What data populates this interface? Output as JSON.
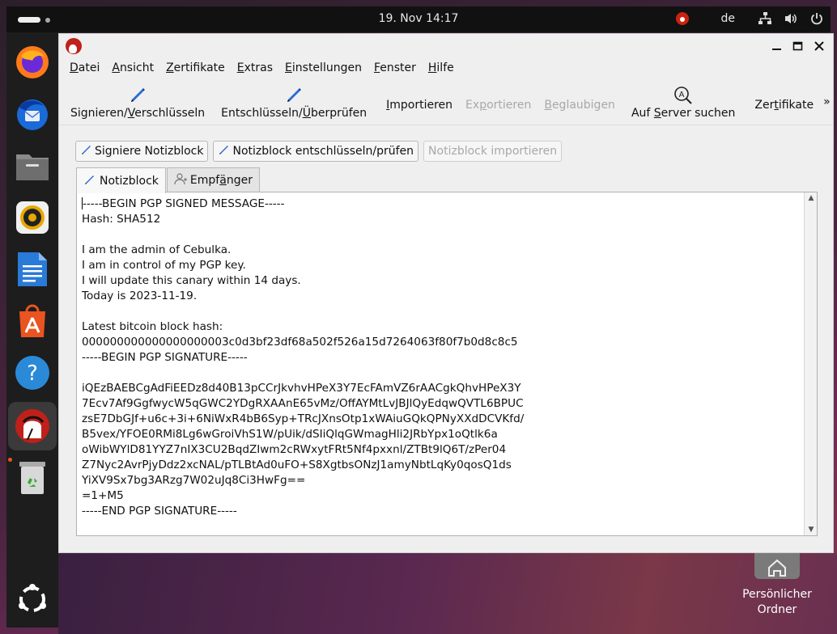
{
  "topbar": {
    "datetime": "19. Nov  14:17",
    "language": "de"
  },
  "dock": {
    "items": [
      "firefox",
      "thunderbird",
      "files",
      "rhythmbox",
      "libreoffice-writer",
      "app-center",
      "help",
      "kleopatra",
      "trash",
      "show-apps"
    ]
  },
  "desktop": {
    "home_folder_line1": "Persönlicher",
    "home_folder_line2": "Ordner"
  },
  "window": {
    "minimize": "—",
    "maximize": "☐",
    "close": "✕"
  },
  "menubar": {
    "datei_u": "D",
    "datei_rest": "atei",
    "ansicht_u": "A",
    "ansicht_rest": "nsicht",
    "zertifikate_u": "Z",
    "zertifikate_rest": "ertifikate",
    "extras_u": "E",
    "extras_rest": "xtras",
    "einstellungen_u": "E",
    "einstellungen_rest": "instellungen",
    "fenster_u": "F",
    "fenster_rest": "enster",
    "hilfe_u": "H",
    "hilfe_rest": "ilfe"
  },
  "toolbar": {
    "sign_a": "Signieren/",
    "sign_u": "V",
    "sign_b": "erschlüsseln",
    "decrypt_a": "Entschlüsseln/",
    "decrypt_u": "Ü",
    "decrypt_b": "berprüfen",
    "import_u": "I",
    "import_b": "mportieren",
    "export_a": "Ex",
    "export_u": "p",
    "export_b": "ortieren",
    "certify_u": "B",
    "certify_b": "eglaubigen",
    "lookup_a": "Auf ",
    "lookup_u": "S",
    "lookup_b": "erver suchen",
    "certificates_a": "Zer",
    "certificates_u": "t",
    "certificates_b": "ifikate",
    "more": "»"
  },
  "actions": {
    "sign_notepad": "Signiere Notizblock",
    "decrypt_notepad": "Notizblock entschlüsseln/prüfen",
    "import_notepad": "Notizblock importieren"
  },
  "tabs": {
    "notepad": "Notizblock",
    "recipients_a": "Empf",
    "recipients_u": "ä",
    "recipients_b": "nger"
  },
  "editor": {
    "content": "-----BEGIN PGP SIGNED MESSAGE-----\nHash: SHA512\n\nI am the admin of Cebulka.\nI am in control of my PGP key.\nI will update this canary within 14 days.\nToday is 2023-11-19.\n\nLatest bitcoin block hash:\n000000000000000000003c0d3bf23df68a502f526a15d7264063f80f7b0d8c8c5\n-----BEGIN PGP SIGNATURE-----\n\niQEzBAEBCgAdFiEEDz8d40B13pCCrJkvhvHPeX3Y7EcFAmVZ6rAACgkQhvHPeX3Y\n7Ecv7Af9GgfwycW5qGWC2YDgRXAAnE65vMz/OffAYMtLvJBJlQyEdqwQVTL6BPUC\nzsE7DbGJf+u6c+3i+6NiWxR4bB6Syp+TRcJXnsOtp1xWAiuGQkQPNyXXdDCVKfd/\nB5vex/YFOE0RMi8Lg6wGroiVhS1W/pUik/dSIiQlqGWmagHli2JRbYpx1oQtlk6a\noWibWYlD81YYZ7nIX3CU2BqdZIwm2cRWxytFRt5Nf4pxxnl/ZTBt9lQ6T/zPer04\nZ7Nyc2AvrPjyDdz2xcNAL/pTLBtAd0uFO+S8XgtbsONzJ1amyNbtLqKy0qosQ1ds\nYiXV9Sx7bg3ARzg7W02uJq8Ci3HwFg==\n=1+M5\n-----END PGP SIGNATURE-----"
  },
  "colors": {
    "ubuntu_orange": "#e95420",
    "kleopatra_red": "#c0201a",
    "pencil_blue": "#2a6ad8"
  }
}
